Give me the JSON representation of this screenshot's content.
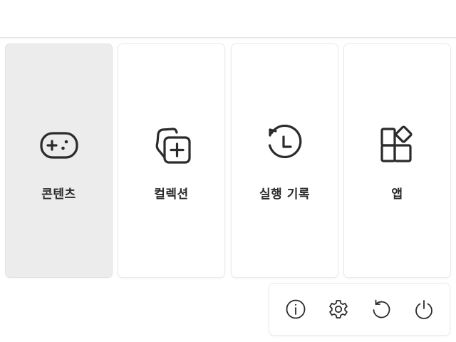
{
  "main_menu": {
    "tiles": [
      {
        "label": "콘텐츠",
        "icon": "gamepad-icon",
        "selected": true
      },
      {
        "label": "컬렉션",
        "icon": "collection-add-icon",
        "selected": false
      },
      {
        "label": "실행 기록",
        "icon": "history-icon",
        "selected": false
      },
      {
        "label": "앱",
        "icon": "apps-icon",
        "selected": false
      }
    ]
  },
  "system_bar": {
    "buttons": [
      {
        "icon": "info-icon"
      },
      {
        "icon": "gear-icon"
      },
      {
        "icon": "restart-icon"
      },
      {
        "icon": "power-icon"
      }
    ]
  },
  "colors": {
    "selected_tile": "#ececec",
    "icon_stroke": "#2b2b2b",
    "background": "#ffffff"
  }
}
